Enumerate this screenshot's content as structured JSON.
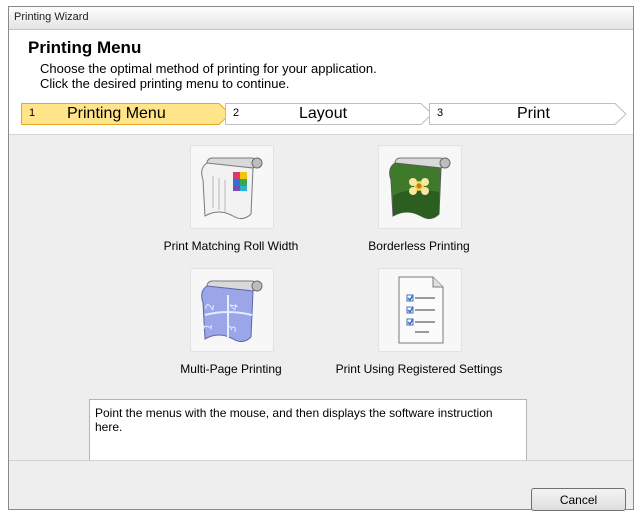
{
  "window": {
    "title": "Printing Wizard"
  },
  "header": {
    "title": "Printing Menu",
    "subtitle_line1": "Choose the optimal method of printing for your application.",
    "subtitle_line2": "Click the desired printing menu to continue."
  },
  "steps": [
    {
      "number": "1",
      "label": "Printing Menu",
      "active": true
    },
    {
      "number": "2",
      "label": "Layout",
      "active": false
    },
    {
      "number": "3",
      "label": "Print",
      "active": false
    }
  ],
  "menus": [
    {
      "label": "Print Matching Roll Width",
      "icon": "roll-width-icon"
    },
    {
      "label": "Borderless Printing",
      "icon": "borderless-flower-icon"
    },
    {
      "label": "Multi-Page Printing",
      "icon": "multi-page-icon"
    },
    {
      "label": "Print Using Registered Settings",
      "icon": "registered-settings-icon"
    }
  ],
  "info": {
    "text": "Point the menus with the mouse, and then displays the software instruction here."
  },
  "footer": {
    "cancel_label": "Cancel"
  },
  "colors": {
    "active_step": "#ffe48a",
    "active_step_border": "#e6a823",
    "inactive_step": "#ffffff"
  }
}
